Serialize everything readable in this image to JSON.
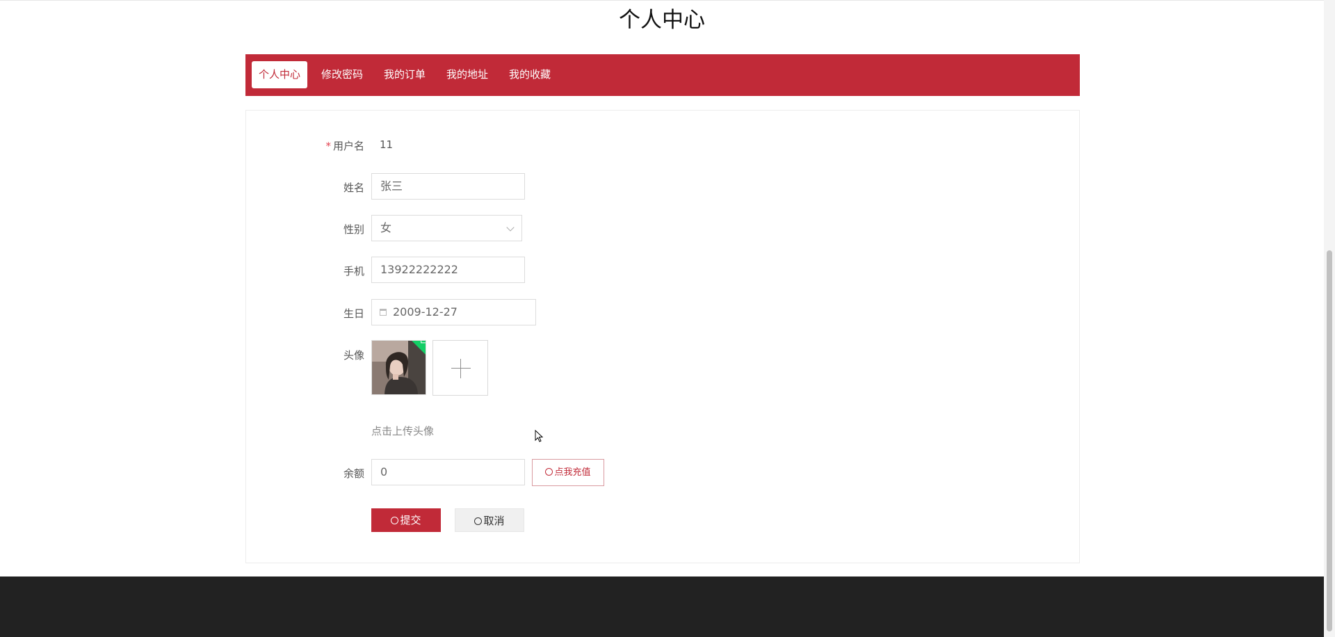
{
  "page": {
    "title": "个人中心"
  },
  "tabs": [
    {
      "label": "个人中心",
      "active": true
    },
    {
      "label": "修改密码",
      "active": false
    },
    {
      "label": "我的订单",
      "active": false
    },
    {
      "label": "我的地址",
      "active": false
    },
    {
      "label": "我的收藏",
      "active": false
    }
  ],
  "form": {
    "username": {
      "label": "用户名",
      "required_mark": "*",
      "value": "11"
    },
    "name": {
      "label": "姓名",
      "value": "张三"
    },
    "gender": {
      "label": "性别",
      "value": "女"
    },
    "phone": {
      "label": "手机",
      "value": "13922222222"
    },
    "birthday": {
      "label": "生日",
      "value": "2009-12-27"
    },
    "avatar": {
      "label": "头像",
      "hint": "点击上传头像"
    },
    "balance": {
      "label": "余额",
      "value": "0",
      "recharge_label": "点我充值"
    },
    "submit_label": "提交",
    "cancel_label": "取消"
  },
  "colors": {
    "brand": "#c12a38",
    "footer": "#222222",
    "success": "#13ce66"
  }
}
